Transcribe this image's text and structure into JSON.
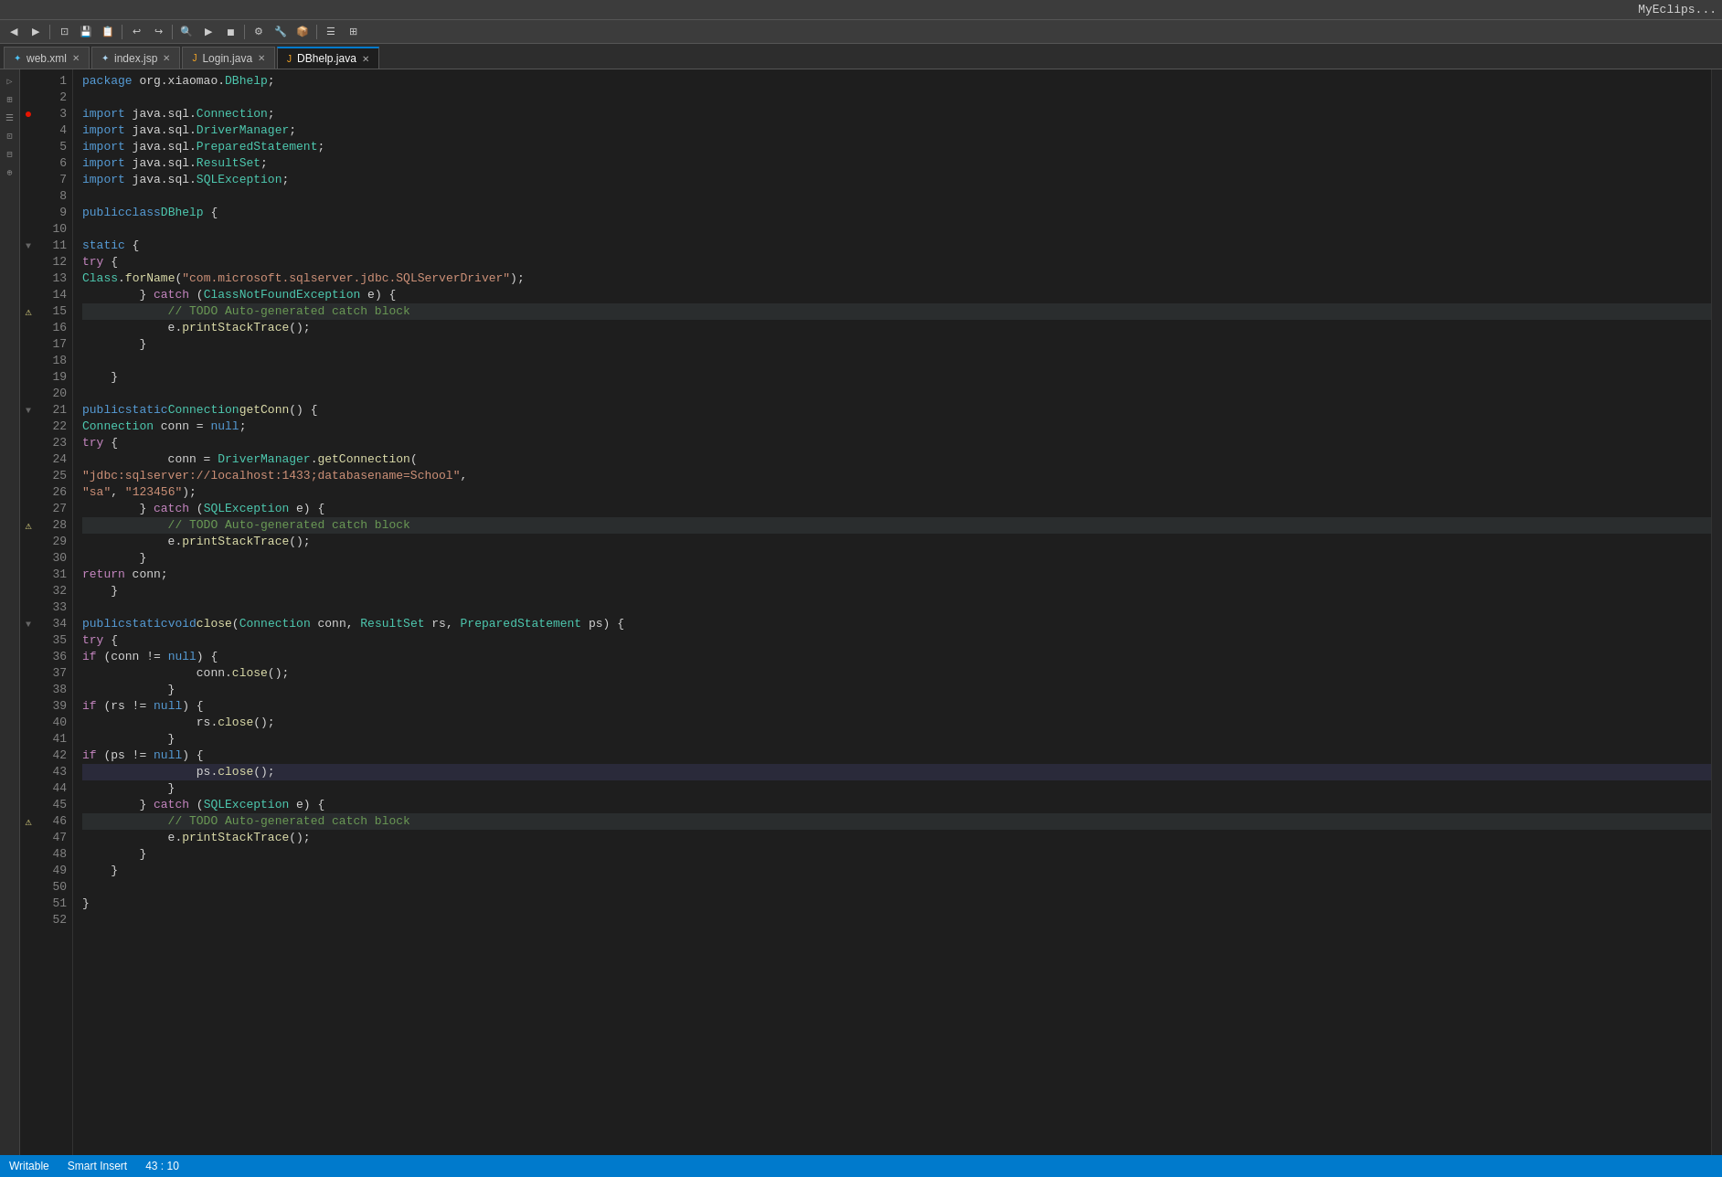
{
  "titleBar": {
    "text": "MyEclips..."
  },
  "tabs": [
    {
      "id": "web-xml",
      "label": "web.xml",
      "active": false,
      "icon": "xml"
    },
    {
      "id": "index-jsp",
      "label": "index.jsp",
      "active": false,
      "icon": "jsp"
    },
    {
      "id": "login-java",
      "label": "Login.java",
      "active": false,
      "icon": "java"
    },
    {
      "id": "dbhelp-java",
      "label": "DBhelp.java",
      "active": true,
      "icon": "java"
    }
  ],
  "statusBar": {
    "writable": "Writable",
    "smartInsert": "Smart Insert",
    "position": "43 : 10"
  },
  "code": {
    "lines": [
      {
        "num": 1,
        "gutter": "",
        "text": "package org.xiaomao.DBhelp;"
      },
      {
        "num": 2,
        "gutter": "",
        "text": ""
      },
      {
        "num": 3,
        "gutter": "bp",
        "text": "import java.sql.Connection;"
      },
      {
        "num": 4,
        "gutter": "",
        "text": "import java.sql.DriverManager;"
      },
      {
        "num": 5,
        "gutter": "",
        "text": "import java.sql.PreparedStatement;"
      },
      {
        "num": 6,
        "gutter": "",
        "text": "import java.sql.ResultSet;"
      },
      {
        "num": 7,
        "gutter": "",
        "text": "import java.sql.SQLException;"
      },
      {
        "num": 8,
        "gutter": "",
        "text": ""
      },
      {
        "num": 9,
        "gutter": "",
        "text": "public class DBhelp {"
      },
      {
        "num": 10,
        "gutter": "",
        "text": ""
      },
      {
        "num": 11,
        "gutter": "collapse",
        "text": "    static {"
      },
      {
        "num": 12,
        "gutter": "",
        "text": "        try {"
      },
      {
        "num": 13,
        "gutter": "",
        "text": "            Class.forName(\"com.microsoft.sqlserver.jdbc.SQLServerDriver\");"
      },
      {
        "num": 14,
        "gutter": "",
        "text": "        } catch (ClassNotFoundException e) {"
      },
      {
        "num": 15,
        "gutter": "warn",
        "text": "            // TODO Auto-generated catch block"
      },
      {
        "num": 16,
        "gutter": "",
        "text": "            e.printStackTrace();"
      },
      {
        "num": 17,
        "gutter": "",
        "text": "        }"
      },
      {
        "num": 18,
        "gutter": "",
        "text": ""
      },
      {
        "num": 19,
        "gutter": "",
        "text": "    }"
      },
      {
        "num": 20,
        "gutter": "",
        "text": ""
      },
      {
        "num": 21,
        "gutter": "collapse",
        "text": "    public static Connection getConn() {"
      },
      {
        "num": 22,
        "gutter": "",
        "text": "        Connection conn = null;"
      },
      {
        "num": 23,
        "gutter": "",
        "text": "        try {"
      },
      {
        "num": 24,
        "gutter": "",
        "text": "            conn = DriverManager.getConnection("
      },
      {
        "num": 25,
        "gutter": "",
        "text": "                    \"jdbc:sqlserver://localhost:1433;databasename=School\","
      },
      {
        "num": 26,
        "gutter": "",
        "text": "                    \"sa\", \"123456\");"
      },
      {
        "num": 27,
        "gutter": "",
        "text": "        } catch (SQLException e) {"
      },
      {
        "num": 28,
        "gutter": "warn",
        "text": "            // TODO Auto-generated catch block"
      },
      {
        "num": 29,
        "gutter": "",
        "text": "            e.printStackTrace();"
      },
      {
        "num": 30,
        "gutter": "",
        "text": "        }"
      },
      {
        "num": 31,
        "gutter": "",
        "text": "        return conn;"
      },
      {
        "num": 32,
        "gutter": "",
        "text": "    }"
      },
      {
        "num": 33,
        "gutter": "",
        "text": ""
      },
      {
        "num": 34,
        "gutter": "collapse",
        "text": "    public static void close(Connection conn, ResultSet rs, PreparedStatement ps) {"
      },
      {
        "num": 35,
        "gutter": "",
        "text": "        try {"
      },
      {
        "num": 36,
        "gutter": "",
        "text": "            if (conn != null) {"
      },
      {
        "num": 37,
        "gutter": "",
        "text": "                conn.close();"
      },
      {
        "num": 38,
        "gutter": "",
        "text": "            }"
      },
      {
        "num": 39,
        "gutter": "",
        "text": "            if (rs != null) {"
      },
      {
        "num": 40,
        "gutter": "",
        "text": "                rs.close();"
      },
      {
        "num": 41,
        "gutter": "",
        "text": "            }"
      },
      {
        "num": 42,
        "gutter": "",
        "text": "            if (ps != null) {"
      },
      {
        "num": 43,
        "gutter": "",
        "text": "                ps.close();"
      },
      {
        "num": 44,
        "gutter": "",
        "text": "            }"
      },
      {
        "num": 45,
        "gutter": "",
        "text": "        } catch (SQLException e) {"
      },
      {
        "num": 46,
        "gutter": "warn",
        "text": "            // TODO Auto-generated catch block"
      },
      {
        "num": 47,
        "gutter": "",
        "text": "            e.printStackTrace();"
      },
      {
        "num": 48,
        "gutter": "",
        "text": "        }"
      },
      {
        "num": 49,
        "gutter": "",
        "text": "    }"
      },
      {
        "num": 50,
        "gutter": "",
        "text": ""
      },
      {
        "num": 51,
        "gutter": "",
        "text": "}"
      },
      {
        "num": 52,
        "gutter": "",
        "text": ""
      }
    ]
  }
}
